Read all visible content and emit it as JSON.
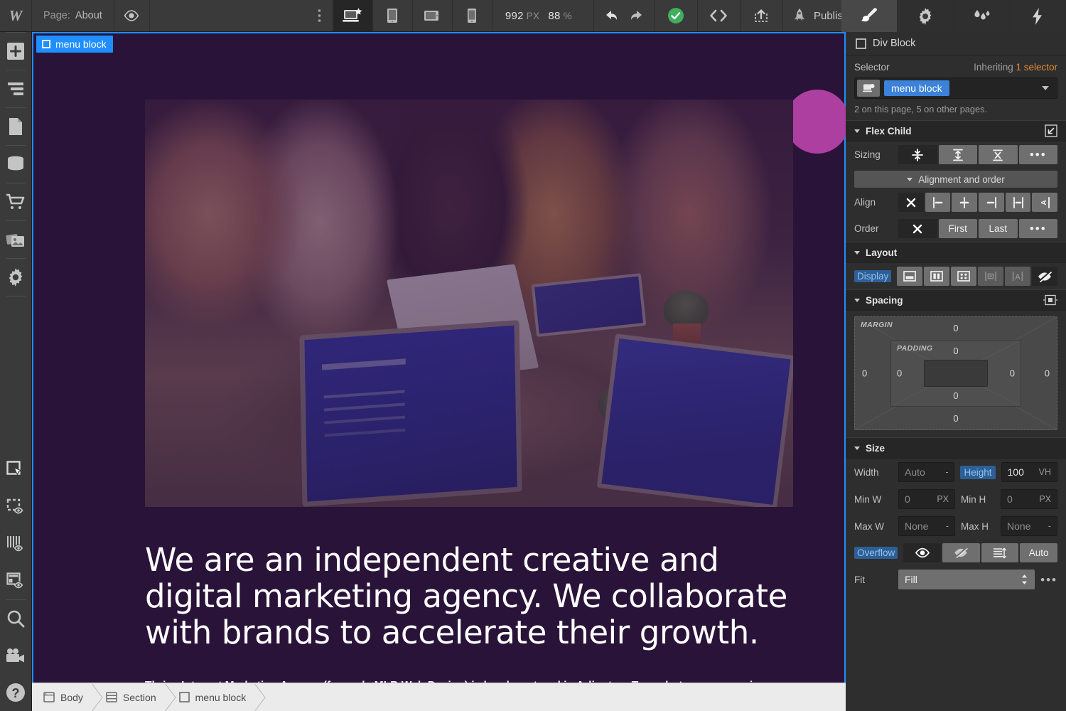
{
  "topbar": {
    "logo": "W",
    "page_key": "Page:",
    "page_name": "About",
    "preview_icon": "eye-icon",
    "more_icon": "more-vertical-icon",
    "devices": [
      {
        "name": "desktop",
        "icon": "desktop-star-icon",
        "active": true
      },
      {
        "name": "tablet",
        "icon": "tablet-icon",
        "active": false
      },
      {
        "name": "tablet-landscape",
        "icon": "tablet-landscape-icon",
        "active": false
      },
      {
        "name": "mobile",
        "icon": "mobile-icon",
        "active": false
      }
    ],
    "zoom_width": "992",
    "zoom_width_unit": "PX",
    "zoom_level": "88",
    "zoom_unit": "%",
    "undo_icon": "undo-icon",
    "redo_icon": "redo-icon",
    "save_status_icon": "check-circle-icon",
    "save_status_color": "#3fae5e",
    "code_icon": "code-brackets-icon",
    "export_icon": "export-icon",
    "publish_icon": "rocket-icon",
    "publish_label": "Publish",
    "publish_caret": "chevron-down-icon",
    "right_tabs": [
      {
        "name": "style",
        "icon": "paintbrush-icon",
        "active": true
      },
      {
        "name": "settings",
        "icon": "gear-icon",
        "active": false
      },
      {
        "name": "effects",
        "icon": "water-drops-icon",
        "active": false
      },
      {
        "name": "interactions",
        "icon": "lightning-bolt-icon",
        "active": false
      }
    ]
  },
  "leftbar": {
    "top_items": [
      {
        "name": "add-elements",
        "icon": "plus-icon"
      },
      {
        "name": "navigator",
        "icon": "layers-icon"
      },
      {
        "name": "pages",
        "icon": "page-icon"
      },
      {
        "name": "cms",
        "icon": "database-icon"
      },
      {
        "name": "ecommerce",
        "icon": "shopping-cart-icon"
      },
      {
        "name": "assets",
        "icon": "images-icon"
      },
      {
        "name": "settings",
        "icon": "gear-icon"
      }
    ],
    "bottom_items": [
      {
        "name": "select-tool",
        "icon": "cursor-select-icon"
      },
      {
        "name": "show-element-outlines",
        "icon": "dashed-box-eye-icon"
      },
      {
        "name": "show-guides",
        "icon": "columns-eye-icon"
      },
      {
        "name": "show-layout",
        "icon": "layout-eye-icon"
      },
      {
        "name": "search",
        "icon": "search-icon"
      },
      {
        "name": "video-tutorials",
        "icon": "video-camera-icon"
      },
      {
        "name": "help",
        "icon": "question-circle-icon"
      }
    ]
  },
  "canvas": {
    "selection_badge": "menu block",
    "selection_badge_icon": "square-outline-icon",
    "selection_color": "#1f8fff",
    "background_color": "#2a1338",
    "decoration_circle_color": "#ad3fa0",
    "hero_image_alt": "team meeting around a table with laptops and tablets",
    "heading": "We are an independent creative and digital marketing agency. We collaborate with brands to accelerate their growth.",
    "body": "Thrive Internet Marketing Agency (formerly MLB Web Design) is headquartered in Arlington, Texas but we are growing and have additional offices in Texas, Florida, Minnesota, New York, California and more!Thrive has"
  },
  "breadcrumb": [
    {
      "label": "Body",
      "icon": "browser-icon"
    },
    {
      "label": "Section",
      "icon": "section-icon"
    },
    {
      "label": "menu block",
      "icon": "square-outline-icon"
    }
  ],
  "inspector": {
    "element_name": "Div Block",
    "element_icon": "square-outline-icon",
    "selector": {
      "label": "Selector",
      "inheriting_prefix": "Inheriting ",
      "inheriting_value": "1 selector",
      "inheriting_color": "#e0893b",
      "state_icon": "selector-state-icon",
      "tag": "menu block",
      "tag_color": "#3b82d8",
      "caret_icon": "chevron-down-icon",
      "usage": "2 on this page, 5 on other pages."
    },
    "flex_child": {
      "title": "Flex Child",
      "expand_icon": "expand-arrow-icon",
      "sizing_label": "Sizing",
      "sizing_buttons": [
        {
          "name": "shrink-if-needed",
          "icon": "shrink-icon",
          "active": true
        },
        {
          "name": "grow-if-possible",
          "icon": "grow-icon",
          "active": false
        },
        {
          "name": "dont-shrink",
          "icon": "no-shrink-icon",
          "active": false
        },
        {
          "name": "sizing-more",
          "icon": "ellipsis-icon",
          "active": false
        }
      ],
      "alignment_toggle": "Alignment and order",
      "align_label": "Align",
      "align_buttons": [
        {
          "name": "align-auto",
          "icon": "x-icon",
          "active": true
        },
        {
          "name": "align-start",
          "icon": "align-start-icon",
          "active": false
        },
        {
          "name": "align-center",
          "icon": "align-center-icon",
          "active": false
        },
        {
          "name": "align-end",
          "icon": "align-end-icon",
          "active": false
        },
        {
          "name": "align-stretch",
          "icon": "align-stretch-icon",
          "active": false
        },
        {
          "name": "align-baseline",
          "icon": "align-baseline-icon",
          "active": false
        }
      ],
      "order_label": "Order",
      "order_buttons": [
        {
          "name": "order-auto",
          "label": "",
          "icon": "x-icon",
          "active": true
        },
        {
          "name": "order-first",
          "label": "First",
          "active": false
        },
        {
          "name": "order-last",
          "label": "Last",
          "active": false
        },
        {
          "name": "order-more",
          "label": "",
          "icon": "ellipsis-icon",
          "active": false
        }
      ]
    },
    "layout": {
      "title": "Layout",
      "display_label": "Display",
      "display_buttons": [
        {
          "name": "display-block",
          "icon": "block-icon",
          "active": false
        },
        {
          "name": "display-flex",
          "icon": "flex-icon",
          "active": false
        },
        {
          "name": "display-grid",
          "icon": "grid-icon",
          "active": false
        },
        {
          "name": "display-inline-block",
          "icon": "inline-block-icon",
          "active": false,
          "dim": true
        },
        {
          "name": "display-inline",
          "icon": "inline-icon",
          "active": false,
          "dim": true
        },
        {
          "name": "display-none",
          "icon": "crossed-eye-icon",
          "active": true
        }
      ]
    },
    "spacing": {
      "title": "Spacing",
      "mode_icon": "spacing-mode-icon",
      "margin_label": "MARGIN",
      "padding_label": "PADDING",
      "margin": {
        "top": "0",
        "right": "0",
        "bottom": "0",
        "left": "0"
      },
      "padding": {
        "top": "0",
        "right": "0",
        "bottom": "0",
        "left": "0"
      }
    },
    "size": {
      "title": "Size",
      "width_label": "Width",
      "width_value": "Auto",
      "width_unit": "-",
      "height_label": "Height",
      "height_value": "100",
      "height_unit": "VH",
      "minw_label": "Min W",
      "minw_value": "0",
      "minw_unit": "PX",
      "minh_label": "Min H",
      "minh_value": "0",
      "minh_unit": "PX",
      "maxw_label": "Max W",
      "maxw_value": "None",
      "maxw_unit": "-",
      "maxh_label": "Max H",
      "maxh_value": "None",
      "maxh_unit": "-",
      "overflow_label": "Overflow",
      "overflow_buttons": [
        {
          "name": "overflow-visible",
          "icon": "eye-icon",
          "active": true
        },
        {
          "name": "overflow-hidden",
          "icon": "crossed-eye-icon",
          "active": false
        },
        {
          "name": "overflow-scroll",
          "icon": "scroll-icon",
          "active": false
        },
        {
          "name": "overflow-auto",
          "label": "Auto",
          "active": false
        }
      ],
      "fit_label": "Fit",
      "fit_value": "Fill",
      "fit_more_icon": "ellipsis-icon"
    }
  }
}
